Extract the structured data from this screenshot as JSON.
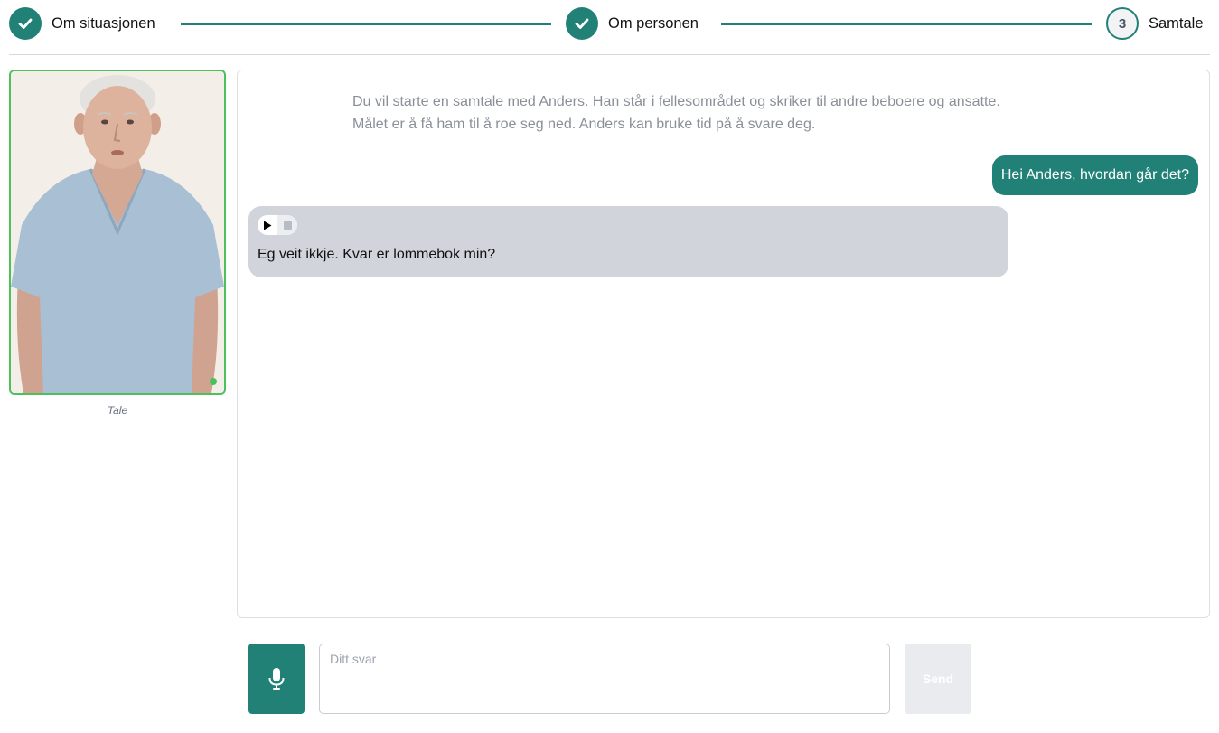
{
  "stepper": {
    "steps": [
      {
        "label": "Om situasjonen",
        "state": "done"
      },
      {
        "label": "Om personen",
        "state": "done"
      },
      {
        "label": "Samtale",
        "number": "3",
        "state": "active"
      }
    ],
    "colors": {
      "accent": "#218177",
      "inactive_bg": "#f1f3f5"
    }
  },
  "avatar": {
    "caption": "Tale",
    "status": "online",
    "status_color": "#4cc05a",
    "icon": "person-portrait"
  },
  "chat": {
    "intro": [
      "Du vil starte en samtale med Anders. Han står i fellesområdet og skriker til andre beboere og ansatte.",
      "Målet er å få ham til å roe seg ned. Anders kan bruke tid på å svare deg."
    ],
    "messages": [
      {
        "role": "user",
        "text": "Hei Anders, hvordan går det?"
      },
      {
        "role": "assistant",
        "text": "Eg veit ikkje. Kvar er lommebok min?",
        "audio": {
          "play_icon": "play-icon",
          "stop_icon": "stop-icon"
        }
      }
    ],
    "colors": {
      "user_bubble": "#218177",
      "assistant_bubble": "#d1d5db"
    }
  },
  "input": {
    "placeholder": "Ditt svar",
    "value": "",
    "mic_icon": "microphone-icon",
    "send_label": "Send"
  }
}
